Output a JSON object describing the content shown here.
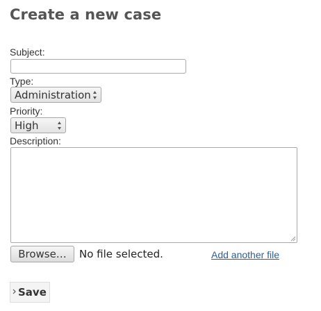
{
  "page": {
    "title": "Create a new case"
  },
  "form": {
    "subject": {
      "label": "Subject:",
      "value": ""
    },
    "type": {
      "label": "Type:",
      "selected": "Administration"
    },
    "priority": {
      "label": "Priority:",
      "selected": "High"
    },
    "description": {
      "label": "Description:",
      "value": ""
    },
    "attachment": {
      "browse_label": "Browse…",
      "status": "No file selected.",
      "add_another_label": "Add another file"
    },
    "save_label": "Save"
  },
  "icons": {
    "select_arrows": "up-down-arrows-icon",
    "resize_grip": "resize-grip-icon",
    "save_chevron": "chevron-right-icon"
  },
  "colors": {
    "link": "#2a5d9a",
    "title": "#555555"
  }
}
